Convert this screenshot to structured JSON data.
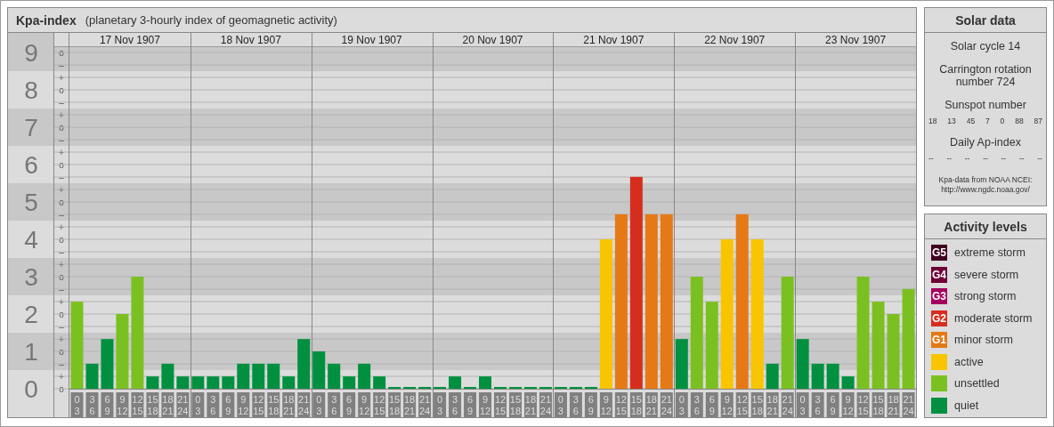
{
  "kpa_panel": {
    "title": "Kpa-index",
    "subtitle": "(planetary 3-hourly index of geomagnetic activity)",
    "minor_tick_labels": [
      "o",
      "–",
      "+",
      "o",
      "–",
      "+",
      "o",
      "–",
      "+",
      "o",
      "–",
      "+",
      "o",
      "–",
      "+",
      "o",
      "–",
      "+",
      "o",
      "–",
      "+",
      "o",
      "–",
      "+",
      "o",
      "–",
      "+",
      "o"
    ],
    "days": [
      {
        "date": "17 Nov 1907",
        "periods": [
          {
            "from": "0",
            "to": "3"
          },
          {
            "from": "3",
            "to": "6"
          },
          {
            "from": "6",
            "to": "9"
          },
          {
            "from": "9",
            "to": "12"
          },
          {
            "from": "12",
            "to": "15"
          },
          {
            "from": "15",
            "to": "18"
          },
          {
            "from": "18",
            "to": "21"
          },
          {
            "from": "21",
            "to": "24"
          }
        ]
      },
      {
        "date": "18 Nov 1907",
        "periods": [
          {
            "from": "0",
            "to": "3"
          },
          {
            "from": "3",
            "to": "6"
          },
          {
            "from": "6",
            "to": "9"
          },
          {
            "from": "9",
            "to": "12"
          },
          {
            "from": "12",
            "to": "15"
          },
          {
            "from": "15",
            "to": "18"
          },
          {
            "from": "18",
            "to": "21"
          },
          {
            "from": "21",
            "to": "24"
          }
        ]
      },
      {
        "date": "19 Nov 1907",
        "periods": [
          {
            "from": "0",
            "to": "3"
          },
          {
            "from": "3",
            "to": "6"
          },
          {
            "from": "6",
            "to": "9"
          },
          {
            "from": "9",
            "to": "12"
          },
          {
            "from": "12",
            "to": "15"
          },
          {
            "from": "15",
            "to": "18"
          },
          {
            "from": "18",
            "to": "21"
          },
          {
            "from": "21",
            "to": "24"
          }
        ]
      },
      {
        "date": "20 Nov 1907",
        "periods": [
          {
            "from": "0",
            "to": "3"
          },
          {
            "from": "3",
            "to": "6"
          },
          {
            "from": "6",
            "to": "9"
          },
          {
            "from": "9",
            "to": "12"
          },
          {
            "from": "12",
            "to": "15"
          },
          {
            "from": "15",
            "to": "18"
          },
          {
            "from": "18",
            "to": "21"
          },
          {
            "from": "21",
            "to": "24"
          }
        ]
      },
      {
        "date": "21 Nov 1907",
        "periods": [
          {
            "from": "0",
            "to": "3"
          },
          {
            "from": "3",
            "to": "6"
          },
          {
            "from": "6",
            "to": "9"
          },
          {
            "from": "9",
            "to": "12"
          },
          {
            "from": "12",
            "to": "15"
          },
          {
            "from": "15",
            "to": "18"
          },
          {
            "from": "18",
            "to": "21"
          },
          {
            "from": "21",
            "to": "24"
          }
        ]
      },
      {
        "date": "22 Nov 1907",
        "periods": [
          {
            "from": "0",
            "to": "3"
          },
          {
            "from": "3",
            "to": "6"
          },
          {
            "from": "6",
            "to": "9"
          },
          {
            "from": "9",
            "to": "12"
          },
          {
            "from": "12",
            "to": "15"
          },
          {
            "from": "15",
            "to": "18"
          },
          {
            "from": "18",
            "to": "21"
          },
          {
            "from": "21",
            "to": "24"
          }
        ]
      },
      {
        "date": "23 Nov 1907",
        "periods": [
          {
            "from": "0",
            "to": "3"
          },
          {
            "from": "3",
            "to": "6"
          },
          {
            "from": "6",
            "to": "9"
          },
          {
            "from": "9",
            "to": "12"
          },
          {
            "from": "12",
            "to": "15"
          },
          {
            "from": "15",
            "to": "18"
          },
          {
            "from": "18",
            "to": "21"
          },
          {
            "from": "21",
            "to": "24"
          }
        ]
      }
    ],
    "chart_data": {
      "type": "bar",
      "ylim": [
        0,
        9
      ],
      "grid": true,
      "categories": [
        null,
        null,
        null,
        null,
        null,
        null,
        null,
        null,
        null,
        null,
        null,
        null,
        null,
        null,
        null,
        null,
        null,
        null,
        null,
        null,
        null,
        null,
        null,
        null,
        null,
        null,
        null,
        null,
        null,
        null,
        null,
        null,
        null,
        null,
        null,
        null,
        null,
        null,
        null,
        null,
        null,
        null,
        null,
        null,
        null,
        null,
        null,
        null,
        null,
        null,
        null,
        null,
        null,
        null,
        null,
        null
      ],
      "yticks": [
        {
          "value": 9,
          "label": "9"
        },
        {
          "value": 8,
          "label": "8"
        },
        {
          "value": 7,
          "label": "7"
        },
        {
          "value": 6,
          "label": "6"
        },
        {
          "value": 5,
          "label": "5"
        },
        {
          "value": 4,
          "label": "4"
        },
        {
          "value": 3,
          "label": "3"
        },
        {
          "value": 2,
          "label": "2"
        },
        {
          "value": 1,
          "label": "1"
        },
        {
          "value": 0,
          "label": "0"
        }
      ],
      "stacked": true,
      "series": [
        {
          "color": "#00903f",
          "values": [
            null,
            0.67,
            1.33,
            null,
            null,
            0.33,
            0.67,
            0.33,
            0.33,
            0.33,
            0.33,
            0.67,
            0.67,
            0.67,
            0.33,
            1.33,
            1,
            0.67,
            0.33,
            0.67,
            0.33,
            0,
            0,
            0,
            0,
            0.33,
            0,
            0.33,
            0,
            0,
            0,
            0,
            0,
            0,
            0,
            null,
            null,
            null,
            null,
            null,
            1.33,
            null,
            null,
            null,
            null,
            null,
            0.67,
            null,
            1.33,
            0.67,
            0.67,
            0.33,
            null,
            null,
            null,
            null
          ]
        },
        {
          "color": "#7bc021",
          "values": [
            2.33,
            null,
            null,
            2,
            3,
            null,
            null,
            null,
            null,
            null,
            null,
            null,
            null,
            null,
            null,
            null,
            null,
            null,
            null,
            null,
            null,
            null,
            null,
            null,
            null,
            null,
            null,
            null,
            null,
            null,
            null,
            null,
            null,
            null,
            null,
            null,
            null,
            null,
            null,
            null,
            null,
            3,
            2.33,
            null,
            null,
            null,
            null,
            3,
            null,
            null,
            null,
            null,
            3,
            2.33,
            2,
            2.67
          ]
        },
        {
          "color": "#f8c500",
          "values": [
            null,
            null,
            null,
            null,
            null,
            null,
            null,
            null,
            null,
            null,
            null,
            null,
            null,
            null,
            null,
            null,
            null,
            null,
            null,
            null,
            null,
            null,
            null,
            null,
            null,
            null,
            null,
            null,
            null,
            null,
            null,
            null,
            null,
            null,
            null,
            4,
            null,
            null,
            null,
            null,
            null,
            null,
            null,
            4,
            null,
            4,
            null,
            null,
            null,
            null,
            null,
            null,
            null,
            null,
            null,
            null
          ]
        },
        {
          "color": "#e57916",
          "values": [
            null,
            null,
            null,
            null,
            null,
            null,
            null,
            null,
            null,
            null,
            null,
            null,
            null,
            null,
            null,
            null,
            null,
            null,
            null,
            null,
            null,
            null,
            null,
            null,
            null,
            null,
            null,
            null,
            null,
            null,
            null,
            null,
            null,
            null,
            null,
            null,
            4.67,
            null,
            4.67,
            4.67,
            null,
            null,
            null,
            null,
            4.67,
            null,
            null,
            null,
            null,
            null,
            null,
            null,
            null,
            null,
            null,
            null
          ]
        },
        {
          "color": "#d62e1e",
          "values": [
            null,
            null,
            null,
            null,
            null,
            null,
            null,
            null,
            null,
            null,
            null,
            null,
            null,
            null,
            null,
            null,
            null,
            null,
            null,
            null,
            null,
            null,
            null,
            null,
            null,
            null,
            null,
            null,
            null,
            null,
            null,
            null,
            null,
            null,
            null,
            null,
            null,
            5.67,
            null,
            null,
            null,
            null,
            null,
            null,
            null,
            null,
            null,
            null,
            null,
            null,
            null,
            null,
            null,
            null,
            null,
            null
          ]
        }
      ]
    }
  },
  "solar_data": {
    "title": "Solar data",
    "solar_cycle": "Solar cycle 14",
    "carrington": "Carrington rotation number 724",
    "sunspot_heading": "Sunspot number",
    "sunspot_numbers": [
      "18",
      "13",
      "45",
      "7",
      "0",
      "88",
      "87"
    ],
    "ap_heading": "Daily Ap-index",
    "ap_values": [
      "--",
      "--",
      "--",
      "--",
      "--",
      "--",
      "--"
    ],
    "source": "Kpa-data from NOAA NCEI: http://www.ngdc.noaa.gov/"
  },
  "activity_levels": {
    "title": "Activity levels",
    "items": [
      {
        "badge": "G5",
        "label": "extreme storm",
        "color": "#3f0022"
      },
      {
        "badge": "G4",
        "label": "severe storm",
        "color": "#6e0038"
      },
      {
        "badge": "G3",
        "label": "strong storm",
        "color": "#a3005c"
      },
      {
        "badge": "G2",
        "label": "moderate storm",
        "color": "#d62e1e"
      },
      {
        "badge": "G1",
        "label": "minor storm",
        "color": "#e57916"
      },
      {
        "label": "active",
        "color": "#f8c500"
      },
      {
        "label": "unsettled",
        "color": "#7bc021"
      },
      {
        "label": "quiet",
        "color": "#00903f"
      }
    ]
  }
}
